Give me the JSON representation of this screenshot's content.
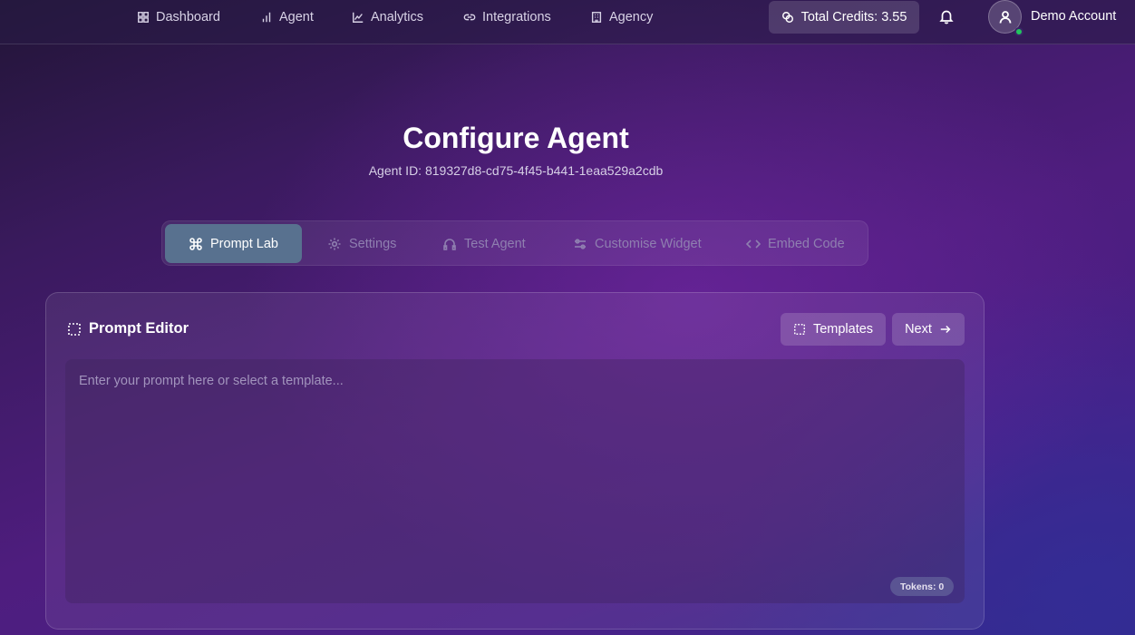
{
  "nav": {
    "items": [
      {
        "label": "Dashboard",
        "icon": "dashboard-icon"
      },
      {
        "label": "Agent",
        "icon": "bar-chart-icon"
      },
      {
        "label": "Analytics",
        "icon": "line-chart-icon"
      },
      {
        "label": "Integrations",
        "icon": "link-icon"
      },
      {
        "label": "Agency",
        "icon": "building-icon"
      }
    ],
    "credits_label": "Total Credits: 3.55",
    "credits_icon": "coins-icon",
    "bell_icon": "bell-icon",
    "account_name": "Demo Account",
    "online_status_color": "#22c55e"
  },
  "header": {
    "title": "Configure Agent",
    "agent_id": "Agent ID: 819327d8-cd75-4f45-b441-1eaa529a2cdb"
  },
  "tabs": [
    {
      "label": "Prompt Lab",
      "icon": "command-icon",
      "active": true
    },
    {
      "label": "Settings",
      "icon": "gear-icon",
      "active": false
    },
    {
      "label": "Test Agent",
      "icon": "audio-icon",
      "active": false
    },
    {
      "label": "Customise Widget",
      "icon": "sliders-icon",
      "active": false
    },
    {
      "label": "Embed Code",
      "icon": "code-icon",
      "active": false
    }
  ],
  "editor": {
    "title": "Prompt Editor",
    "templates_label": "Templates",
    "next_label": "Next",
    "placeholder": "Enter your prompt here or select a template...",
    "value": "",
    "tokens_label": "Tokens: 0"
  },
  "colors": {
    "active_tab": "#58718f",
    "inactive_tab_text": "#8f7fb0"
  }
}
